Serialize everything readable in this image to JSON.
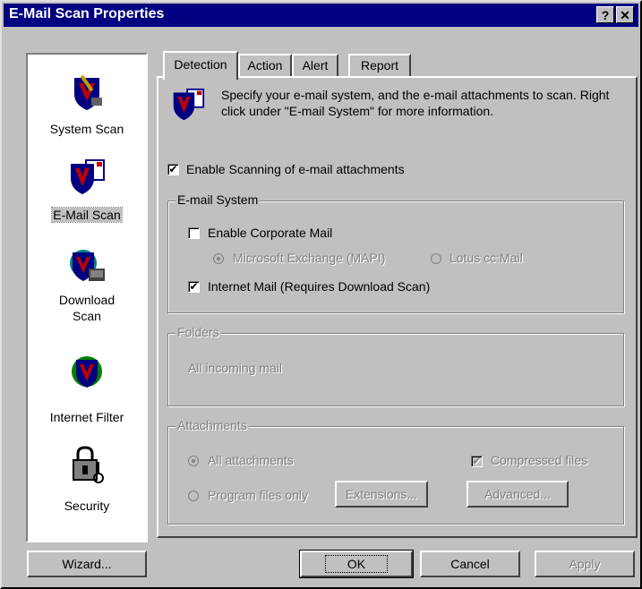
{
  "window": {
    "title": "E-Mail Scan Properties",
    "help_label": "?",
    "close_label": "✕"
  },
  "sidebar": {
    "items": [
      {
        "label": "System Scan"
      },
      {
        "label": "E-Mail Scan"
      },
      {
        "label": "Download Scan"
      },
      {
        "label": "Internet Filter"
      },
      {
        "label": "Security"
      }
    ]
  },
  "tabs": [
    {
      "label": "Detection"
    },
    {
      "label": "Action"
    },
    {
      "label": "Alert"
    },
    {
      "label": "Report"
    }
  ],
  "detection": {
    "description": "Specify your e-mail system, and the e-mail attachments to scan. Right click under \"E-mail System\" for more information.",
    "enable_scanning": {
      "label": "Enable Scanning of e-mail attachments",
      "checked": true
    },
    "email_system": {
      "legend": "E-mail System",
      "corporate": {
        "label": "Enable Corporate Mail",
        "checked": false
      },
      "exchange": {
        "label": "Microsoft Exchange (MAPI)",
        "selected": true
      },
      "lotus": {
        "label": "Lotus cc:Mail",
        "selected": false
      },
      "internet": {
        "label": "Internet Mail (Requires Download Scan)",
        "checked": true
      }
    },
    "folders": {
      "legend": "Folders",
      "text": "All incoming mail"
    },
    "attachments": {
      "legend": "Attachments",
      "all": {
        "label": "All attachments",
        "selected": true
      },
      "program": {
        "label": "Program files only",
        "selected": false
      },
      "extensions_label": "Extensions...",
      "compressed": {
        "label": "Compressed files",
        "checked": true
      },
      "advanced_label": "Advanced..."
    }
  },
  "footer": {
    "wizard_label": "Wizard...",
    "ok_label": "OK",
    "cancel_label": "Cancel",
    "apply_label": "Apply"
  },
  "colors": {
    "titlebar": "#000080",
    "face": "#c0c0c0",
    "shield_red": "#c00000",
    "shield_navy": "#000080"
  }
}
